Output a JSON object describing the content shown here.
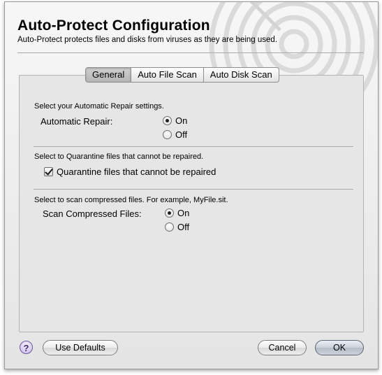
{
  "header": {
    "title": "Auto-Protect Configuration",
    "subtitle": "Auto-Protect protects files and disks from viruses as they are being used."
  },
  "tabs": [
    {
      "label": "General",
      "selected": true
    },
    {
      "label": "Auto File Scan",
      "selected": false
    },
    {
      "label": "Auto Disk Scan",
      "selected": false
    }
  ],
  "repair": {
    "instruction": "Select your Automatic Repair settings.",
    "label": "Automatic Repair:",
    "options": [
      "On",
      "Off"
    ],
    "selected": "On"
  },
  "quarantine": {
    "instruction": "Select to Quarantine files that cannot be repaired.",
    "checkbox_label": "Quarantine files that cannot be repaired",
    "checked": true
  },
  "compressed": {
    "instruction": "Select to scan compressed files.  For example, MyFile.sit.",
    "label": "Scan Compressed Files:",
    "options": [
      "On",
      "Off"
    ],
    "selected": "On"
  },
  "footer": {
    "help_icon": "question-mark-icon",
    "help_glyph": "?",
    "use_defaults_label": "Use Defaults",
    "cancel_label": "Cancel",
    "ok_label": "OK"
  },
  "colors": {
    "window_bg": "#ececec",
    "panel_bg": "#e6e6e6",
    "help_accent": "#c9b8ea",
    "default_button": "#b3bcc7"
  }
}
